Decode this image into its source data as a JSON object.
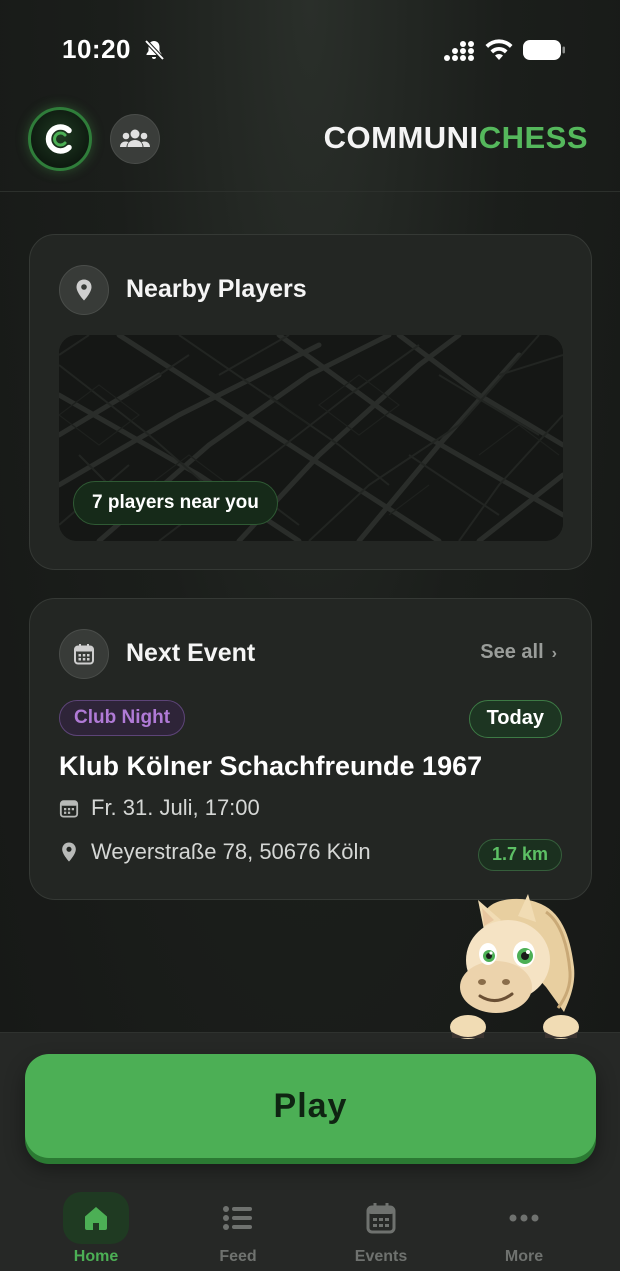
{
  "status_bar": {
    "time": "10:20"
  },
  "header": {
    "logo_letter": "C",
    "brand_part1": "COMMUNI",
    "brand_part2": "CHESS"
  },
  "nearby": {
    "title": "Nearby Players",
    "players_near_label": "7 players near you"
  },
  "next_event": {
    "title": "Next Event",
    "see_all_label": "See all",
    "category": "Club Night",
    "when_badge": "Today",
    "name": "Klub Kölner Schachfreunde 1967",
    "date": "Fr. 31. Juli, 17:00",
    "address": "Weyerstraße 78, 50676 Köln",
    "distance": "1.7 km"
  },
  "play_button_label": "Play",
  "tabs": [
    {
      "label": "Home",
      "icon": "home-icon",
      "active": true
    },
    {
      "label": "Feed",
      "icon": "list-icon",
      "active": false
    },
    {
      "label": "Events",
      "icon": "calendar-icon",
      "active": false
    },
    {
      "label": "More",
      "icon": "more-dots-icon",
      "active": false
    }
  ],
  "colors": {
    "accent": "#4caf55",
    "background": "#1a1d1a",
    "card": "#232623",
    "club_tag": "#b07ad6"
  }
}
